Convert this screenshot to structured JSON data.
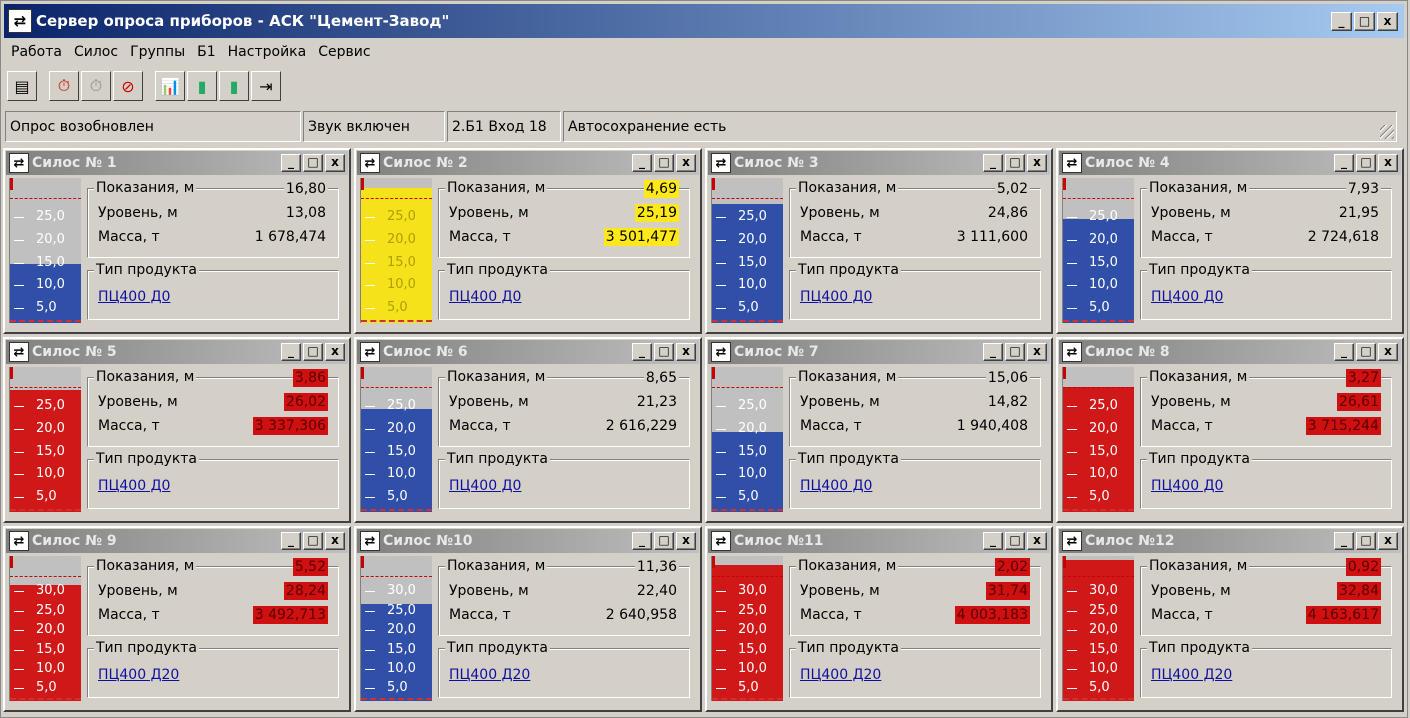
{
  "window": {
    "title": "Сервер опроса приборов - АСК \"Цемент-Завод\"",
    "icon": "app-icon",
    "controls": {
      "minimize": "_",
      "maximize": "□",
      "close": "x"
    }
  },
  "menu": [
    "Работа",
    "Силос",
    "Группы",
    "Б1",
    "Настройка",
    "Сервис"
  ],
  "toolbar": [
    {
      "name": "list-icon",
      "glyph": "▤"
    },
    {
      "name": "sep"
    },
    {
      "name": "stopwatch-red-icon",
      "glyph": "⏱"
    },
    {
      "name": "stopwatch-gray-icon",
      "glyph": "⏱"
    },
    {
      "name": "stop-sound-icon",
      "glyph": "⊘"
    },
    {
      "name": "sep"
    },
    {
      "name": "chart-icon",
      "glyph": "📊"
    },
    {
      "name": "device-icon",
      "glyph": "▮"
    },
    {
      "name": "device-settings-icon",
      "glyph": "▮"
    },
    {
      "name": "exit-icon",
      "glyph": "⇥"
    }
  ],
  "status": [
    "Опрос возобновлен",
    "Звук включен",
    "2.Б1 Вход 18",
    "Автосохранение есть"
  ],
  "labels": {
    "reading": "Показания, м",
    "level": "Уровень, м",
    "mass": "Масса, т",
    "product_type": "Тип продукта"
  },
  "colors": {
    "blue": "#2f4fa8",
    "red": "#d01818",
    "yellow": "#f5e21a",
    "gray": "#c0c0c0"
  },
  "silos": [
    {
      "name": "Силос № 1",
      "reading": "16,80",
      "level": "13,08",
      "mass": "1 678,474",
      "alert": "",
      "product": "ПЦ400 Д0",
      "fill_pct": 0.41,
      "fill_color": "blue",
      "ticks": [
        "25,0",
        "20,0",
        "15,0",
        "10,0",
        "5,0"
      ]
    },
    {
      "name": "Силос № 2",
      "reading": "4,69",
      "level": "25,19",
      "mass": "3 501,477",
      "alert": "yel",
      "product": "ПЦ400 Д0",
      "fill_pct": 0.93,
      "fill_color": "yellow",
      "ticks": [
        "25,0",
        "20,0",
        "15,0",
        "10,0",
        "5,0"
      ]
    },
    {
      "name": "Силос № 3",
      "reading": "5,02",
      "level": "24,86",
      "mass": "3 111,600",
      "alert": "",
      "product": "ПЦ400 Д0",
      "fill_pct": 0.82,
      "fill_color": "blue",
      "ticks": [
        "25,0",
        "20,0",
        "15,0",
        "10,0",
        "5,0"
      ]
    },
    {
      "name": "Силос № 4",
      "reading": "7,93",
      "level": "21,95",
      "mass": "2 724,618",
      "alert": "",
      "product": "ПЦ400 Д0",
      "fill_pct": 0.72,
      "fill_color": "blue",
      "ticks": [
        "25,0",
        "20,0",
        "15,0",
        "10,0",
        "5,0"
      ]
    },
    {
      "name": "Силос № 5",
      "reading": "3,86",
      "level": "26,02",
      "mass": "3 337,306",
      "alert": "red",
      "product": "ПЦ400 Д0",
      "fill_pct": 0.84,
      "fill_color": "red",
      "ticks": [
        "25,0",
        "20,0",
        "15,0",
        "10,0",
        "5,0"
      ]
    },
    {
      "name": "Силос № 6",
      "reading": "8,65",
      "level": "21,23",
      "mass": "2 616,229",
      "alert": "",
      "product": "ПЦ400 Д0",
      "fill_pct": 0.71,
      "fill_color": "blue",
      "ticks": [
        "25,0",
        "20,0",
        "15,0",
        "10,0",
        "5,0"
      ]
    },
    {
      "name": "Силос № 7",
      "reading": "15,06",
      "level": "14,82",
      "mass": "1 940,408",
      "alert": "",
      "product": "ПЦ400 Д0",
      "fill_pct": 0.55,
      "fill_color": "blue",
      "ticks": [
        "25,0",
        "20,0",
        "15,0",
        "10,0",
        "5,0"
      ]
    },
    {
      "name": "Силос № 8",
      "reading": "3,27",
      "level": "26,61",
      "mass": "3 715,244",
      "alert": "red",
      "product": "ПЦ400 Д0",
      "fill_pct": 0.86,
      "fill_color": "red",
      "ticks": [
        "25,0",
        "20,0",
        "15,0",
        "10,0",
        "5,0"
      ]
    },
    {
      "name": "Силос № 9",
      "reading": "5,52",
      "level": "28,24",
      "mass": "3 492,713",
      "alert": "red",
      "product": "ПЦ400 Д20",
      "fill_pct": 0.8,
      "fill_color": "red",
      "ticks": [
        "30,0",
        "25,0",
        "20,0",
        "15,0",
        "10,0",
        "5,0"
      ]
    },
    {
      "name": "Силос №10",
      "reading": "11,36",
      "level": "22,40",
      "mass": "2 640,958",
      "alert": "",
      "product": "ПЦ400 Д20",
      "fill_pct": 0.67,
      "fill_color": "blue",
      "ticks": [
        "30,0",
        "25,0",
        "20,0",
        "15,0",
        "10,0",
        "5,0"
      ]
    },
    {
      "name": "Силос №11",
      "reading": "2,02",
      "level": "31,74",
      "mass": "4 003,183",
      "alert": "red",
      "product": "ПЦ400 Д20",
      "fill_pct": 0.94,
      "fill_color": "red",
      "ticks": [
        "30,0",
        "25,0",
        "20,0",
        "15,0",
        "10,0",
        "5,0"
      ]
    },
    {
      "name": "Силос №12",
      "reading": "0,92",
      "level": "32,84",
      "mass": "4 163,617",
      "alert": "red",
      "product": "ПЦ400 Д20",
      "fill_pct": 0.97,
      "fill_color": "red",
      "ticks": [
        "30,0",
        "25,0",
        "20,0",
        "15,0",
        "10,0",
        "5,0"
      ]
    }
  ]
}
